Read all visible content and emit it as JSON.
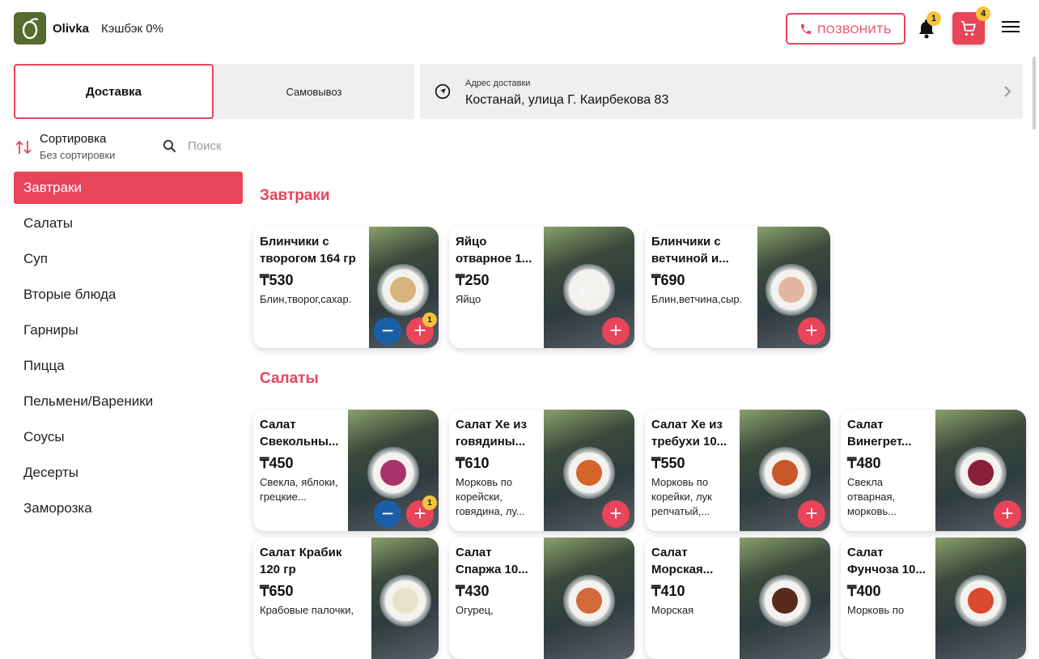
{
  "header": {
    "brand": "Olivka",
    "cashback": "Кэшбэк 0%",
    "call_label": "ПОЗВОНИТЬ",
    "notifications_count": "1",
    "cart_count": "4"
  },
  "delivery": {
    "tab_delivery": "Доставка",
    "tab_pickup": "Самовывоз",
    "address_label": "Адрес доставки",
    "address_value": "Костанай, улица Г. Каирбекова 83"
  },
  "sort": {
    "title": "Сортировка",
    "value": "Без сортировки"
  },
  "search": {
    "placeholder": "Поиск"
  },
  "categories": [
    "Завтраки",
    "Салаты",
    "Суп",
    "Вторые блюда",
    "Гарниры",
    "Пицца",
    "Пельмени/Вареники",
    "Соусы",
    "Десерты",
    "Заморозка"
  ],
  "sections": {
    "breakfast": {
      "title": "Завтраки",
      "items": [
        {
          "name": "Блинчики с творогом 164 гр",
          "price": "₸530",
          "desc": "Блин,творог,сахар.",
          "qty": "1"
        },
        {
          "name": "Яйцо отварное 1...",
          "price": "₸250",
          "desc": "Яйцо"
        },
        {
          "name": "Блинчики с ветчиной и...",
          "price": "₸690",
          "desc": "Блин,ветчина,сыр."
        }
      ]
    },
    "salads": {
      "title": "Салаты",
      "items": [
        {
          "name": "Салат Свекольны...",
          "price": "₸450",
          "desc": "Свекла, яблоки, грецкие...",
          "qty": "1"
        },
        {
          "name": "Салат Хе из говядины...",
          "price": "₸610",
          "desc": "Морковь по корейски, говядина, лу..."
        },
        {
          "name": "Салат Хе из требухи 10...",
          "price": "₸550",
          "desc": "Морковь по корейки, лук репчатый,..."
        },
        {
          "name": "Салат Винегрет...",
          "price": "₸480",
          "desc": "Свекла отварная, морковь..."
        },
        {
          "name": "Салат Крабик 120 гр",
          "price": "₸650",
          "desc": "Крабовые палочки,"
        },
        {
          "name": "Салат Спаржа 10...",
          "price": "₸430",
          "desc": "Огурец,"
        },
        {
          "name": "Салат Морская...",
          "price": "₸410",
          "desc": "Морская"
        },
        {
          "name": "Салат Фунчоза 10...",
          "price": "₸400",
          "desc": "Морковь по"
        }
      ]
    }
  },
  "colors": {
    "accent": "#e8445a",
    "minus": "#1b5ea8",
    "badge": "#f6c33d"
  }
}
